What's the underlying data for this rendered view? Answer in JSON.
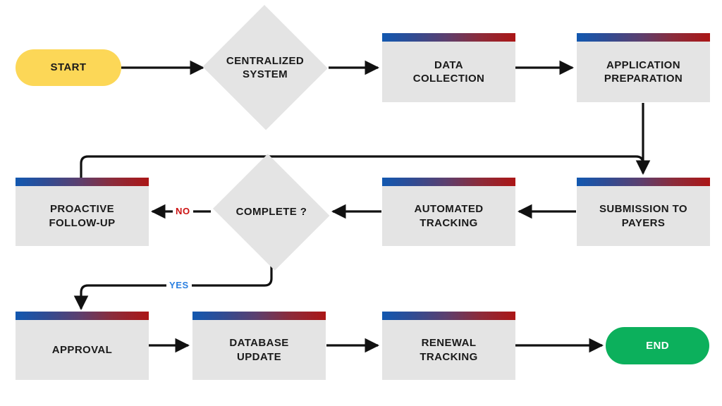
{
  "diagram": {
    "title": "Insurance Credentialing Process Flowchart",
    "background_color": "#ffffff",
    "process_fill": "#e4e4e4",
    "process_bar_gradient_from": "#1258b0",
    "process_bar_gradient_to": "#ab1616",
    "start_color": "#fcd757",
    "end_color": "#0cb05c",
    "edge_color": "#111111",
    "yes_label_color": "#2a7fe0",
    "no_label_color": "#cc1111"
  },
  "nodes": {
    "start": {
      "label": "START",
      "shape": "terminator"
    },
    "centralized": {
      "label": "CENTRALIZED\nSYSTEM",
      "shape": "decision"
    },
    "data": {
      "label": "DATA\nCOLLECTION",
      "shape": "process"
    },
    "application": {
      "label": "APPLICATION\nPREPARATION",
      "shape": "process"
    },
    "submission": {
      "label": "SUBMISSION TO\nPAYERS",
      "shape": "process"
    },
    "tracking": {
      "label": "AUTOMATED\nTRACKING",
      "shape": "process"
    },
    "complete": {
      "label": "COMPLETE ?",
      "shape": "decision"
    },
    "followup": {
      "label": "PROACTIVE\nFOLLOW-UP",
      "shape": "process"
    },
    "approval": {
      "label": "APPROVAL",
      "shape": "process"
    },
    "database": {
      "label": "DATABASE\nUPDATE",
      "shape": "process"
    },
    "renewal": {
      "label": "RENEWAL\nTRACKING",
      "shape": "process"
    },
    "end": {
      "label": "END",
      "shape": "terminator"
    }
  },
  "edge_labels": {
    "no": "NO",
    "yes": "YES"
  },
  "edges": [
    {
      "from": "start",
      "to": "centralized",
      "label": ""
    },
    {
      "from": "centralized",
      "to": "data",
      "label": ""
    },
    {
      "from": "data",
      "to": "application",
      "label": ""
    },
    {
      "from": "application",
      "to": "submission",
      "label": ""
    },
    {
      "from": "submission",
      "to": "tracking",
      "label": ""
    },
    {
      "from": "tracking",
      "to": "complete",
      "label": ""
    },
    {
      "from": "complete",
      "to": "followup",
      "label": "NO"
    },
    {
      "from": "followup",
      "to": "submission",
      "label": ""
    },
    {
      "from": "complete",
      "to": "approval",
      "label": "YES"
    },
    {
      "from": "approval",
      "to": "database",
      "label": ""
    },
    {
      "from": "database",
      "to": "renewal",
      "label": ""
    },
    {
      "from": "renewal",
      "to": "end",
      "label": ""
    }
  ]
}
